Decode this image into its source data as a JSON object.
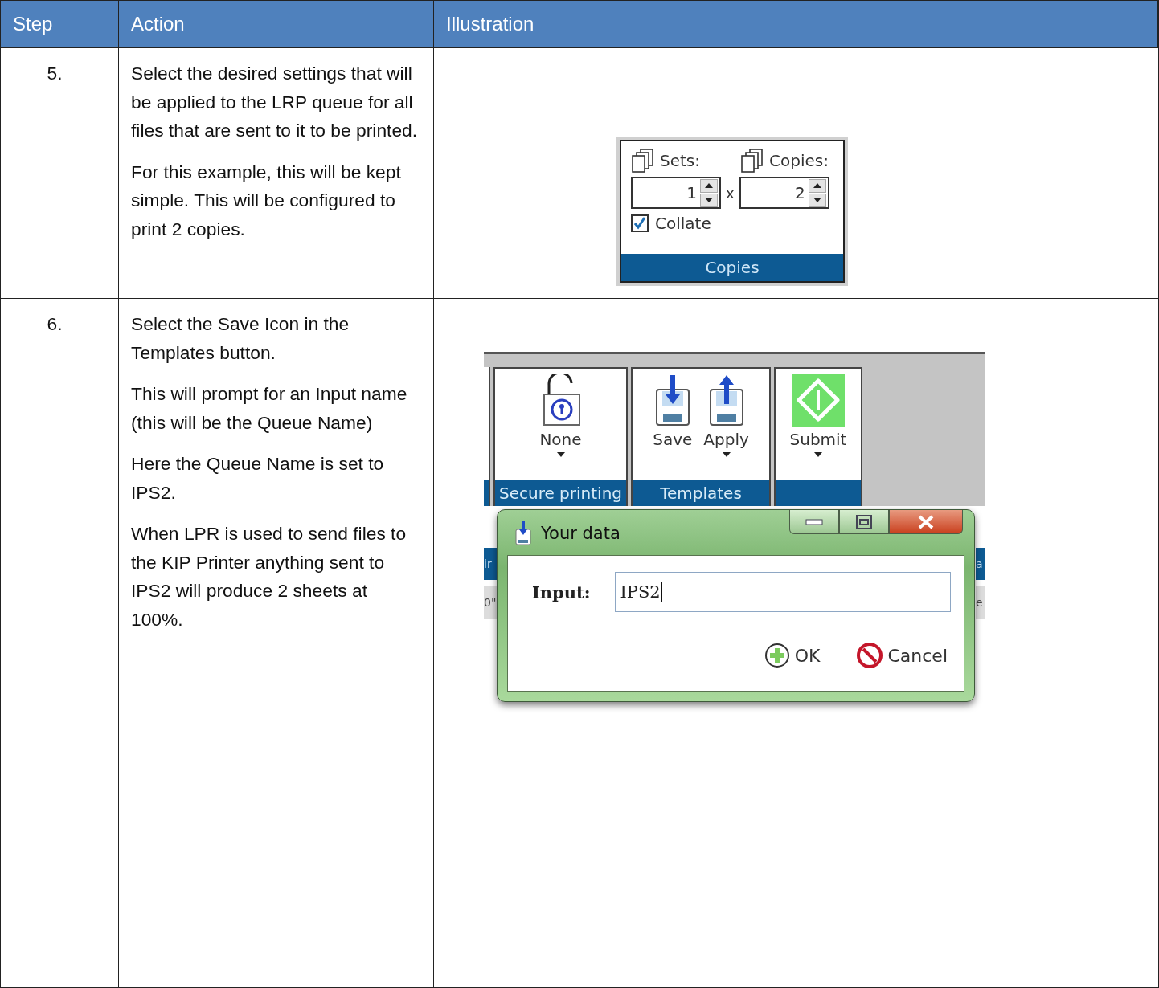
{
  "table": {
    "columns": [
      "Step",
      "Action",
      "Illustration"
    ],
    "rows": [
      {
        "step": "5.",
        "paragraphs": [
          "Select the desired settings that will be applied to the LRP queue for all files that are sent to it to be printed.",
          "For this example, this will be kept simple. This will be configured to print 2 copies."
        ],
        "illustration": {
          "kind": "copies_panel",
          "sets_label": "Sets:",
          "sets_value": "1",
          "times": "x",
          "copies_label": "Copies:",
          "copies_value": "2",
          "collate": {
            "label": "Collate",
            "checked": true
          },
          "group_label": "Copies"
        }
      },
      {
        "step": "6.",
        "paragraphs": [
          "Select the Save Icon in the Templates button.",
          "This will prompt for an Input name (this will be the Queue Name)",
          "Here the Queue Name is set to IPS2.",
          "When LPR is used to send files to the KIP Printer anything sent to IPS2 will produce 2 sheets at 100%."
        ],
        "illustration": {
          "kind": "ribbon_dialog",
          "groups": [
            {
              "label": "Secure printing",
              "buttons": [
                {
                  "label": "None",
                  "dropdown": true
                }
              ]
            },
            {
              "label": "Templates",
              "buttons": [
                {
                  "label": "Save",
                  "dropdown": false
                },
                {
                  "label": "Apply",
                  "dropdown": true
                }
              ]
            },
            {
              "buttons": [
                {
                  "label": "Submit",
                  "dropdown": true
                }
              ]
            }
          ],
          "behind_left": [
            "ir",
            "0\""
          ],
          "behind_right": [
            "a",
            "e"
          ],
          "dialog": {
            "title": "Your data",
            "field_label": "Input:",
            "value": "IPS2",
            "buttons": [
              {
                "kind": "ok",
                "label": "OK"
              },
              {
                "kind": "cancel",
                "label": "Cancel"
              }
            ]
          }
        }
      }
    ]
  }
}
